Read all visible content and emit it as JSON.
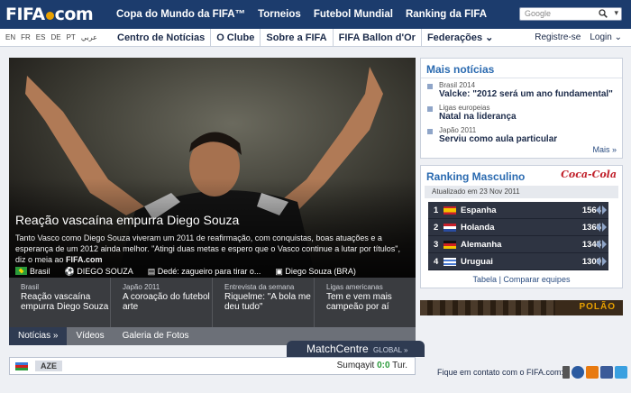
{
  "header": {
    "logo": "FIFA.com",
    "nav": [
      "Copa do Mundo da FIFA™",
      "Torneios",
      "Futebol Mundial",
      "Ranking da FIFA"
    ],
    "search_label": "Google"
  },
  "subheader": {
    "languages": [
      "EN",
      "FR",
      "ES",
      "DE",
      "PT",
      "عربي"
    ],
    "nav": [
      "Centro de Notícias",
      "O Clube",
      "Sobre a FIFA",
      "FIFA Ballon d'Or",
      "Federações ⌄"
    ],
    "register": "Registre-se",
    "login": "Login ⌄"
  },
  "hero": {
    "title": "Reação vascaína empurra Diego Souza",
    "text": "Tanto Vasco como Diego Souza viveram um 2011 de reafirmação, com conquistas, boas atuações e a esperança de um 2012 ainda melhor. \"Atingi duas metas e espero que o Vasco continue a lutar por títulos\", diz o meia ao",
    "source": "FIFA.com",
    "tags": [
      "Brasil",
      "DIEGO SOUZA",
      "Dedé: zagueiro para tirar o...",
      "Diego Souza (BRA)"
    ]
  },
  "subnews": [
    {
      "category": "Brasil",
      "title": "Reação vascaína empurra Diego Souza"
    },
    {
      "category": "Japão 2011",
      "title": "A coroação do futebol arte"
    },
    {
      "category": "Entrevista da semana",
      "title": "Riquelme: \"A bola me deu tudo\""
    },
    {
      "category": "Ligas americanas",
      "title": "Tem e vem mais campeão por aí"
    }
  ],
  "tabs": [
    "Notícias »",
    "Vídeos",
    "Galeria de Fotos"
  ],
  "matchcentre": {
    "title": "MatchCentre",
    "tag": "GLOBAL »",
    "team_home": "AZE",
    "home": "Sumqayit",
    "score": "0:0",
    "away": "Tur."
  },
  "more_news": {
    "title": "Mais notícias",
    "items": [
      {
        "category": "Brasil 2014",
        "title": "Valcke: \"2012 será um ano fundamental\""
      },
      {
        "category": "Ligas europeias",
        "title": "Natal na liderança"
      },
      {
        "category": "Japão 2011",
        "title": "Serviu como aula particular"
      }
    ],
    "more": "Mais »"
  },
  "ranking": {
    "title": "Ranking Masculino",
    "sponsor": "Coca-Cola",
    "updated": "Atualizado em 23 Nov 2011",
    "rows": [
      {
        "pos": "1",
        "country": "Espanha",
        "points": "1564"
      },
      {
        "pos": "2",
        "country": "Holanda",
        "points": "1365"
      },
      {
        "pos": "3",
        "country": "Alemanha",
        "points": "1345"
      },
      {
        "pos": "4",
        "country": "Uruguai",
        "points": "1309"
      }
    ],
    "link_table": "Tabela",
    "link_compare": "Comparar equipes"
  },
  "ad": {
    "text": "POLÃO"
  },
  "footer": {
    "contact": "Fique em contato com o FIFA.com:"
  }
}
